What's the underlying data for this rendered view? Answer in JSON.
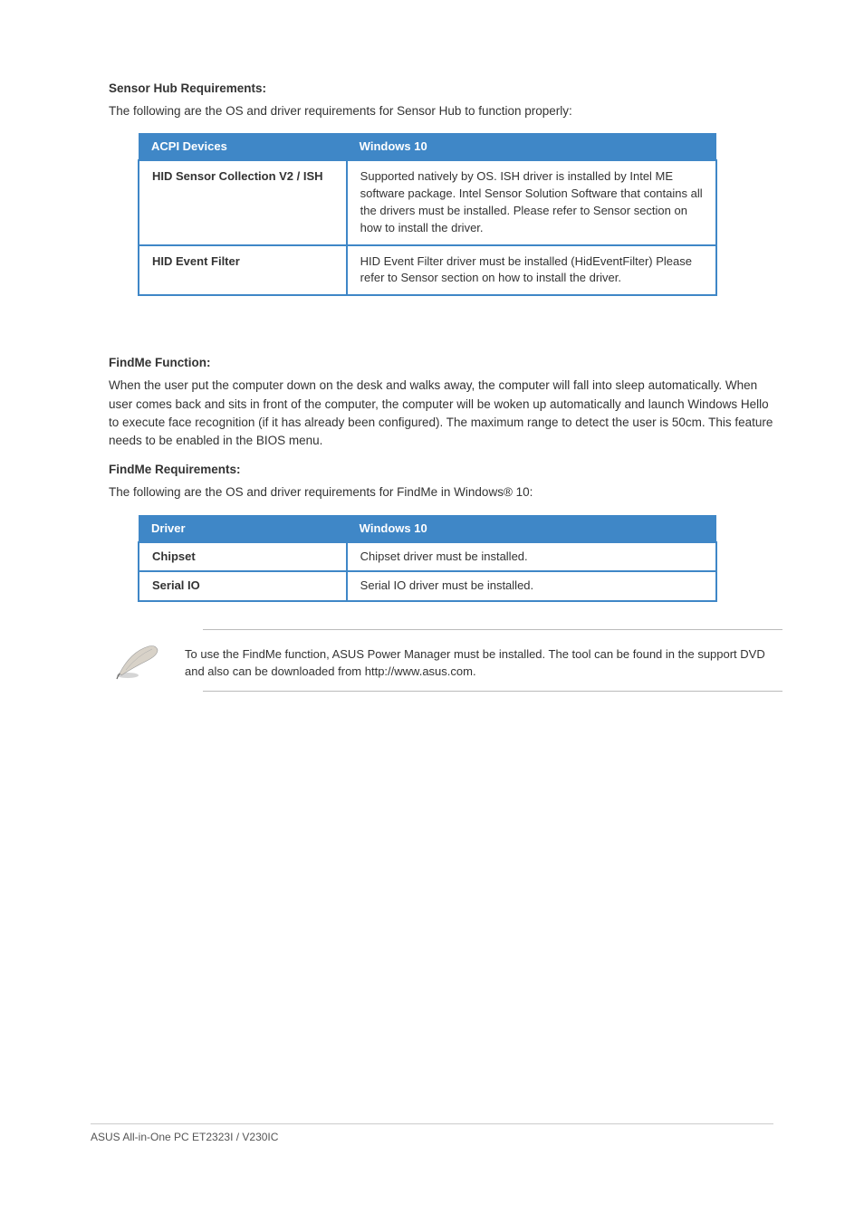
{
  "s1": {
    "title": "Sensor Hub Requirements:",
    "lead": "The following are the OS and driver requirements for Sensor Hub to function properly:",
    "table_header_left": "ACPI Devices",
    "table_header_right": "Windows 10",
    "rows": [
      {
        "left": "HID Sensor Collection V2 / ISH",
        "right": "Supported natively by OS. ISH driver is installed by Intel ME software package. Intel Sensor Solution Software that contains all the drivers must be installed. Please refer to Sensor section on how to install the driver."
      },
      {
        "left": "HID Event Filter",
        "right": "HID Event Filter driver must be installed (HidEventFilter) Please refer to Sensor section on how to install the driver."
      }
    ]
  },
  "s2": {
    "title": "FindMe Function:",
    "lead": "When the user put the computer down on the desk and walks away, the computer will fall into sleep automatically. When user comes back and sits in front of the computer, the computer will be woken up automatically and launch Windows Hello to execute face recognition (if it has already been configured). The maximum range to detect the user is 50cm. This feature needs to be enabled in the BIOS menu.",
    "subtitle": "FindMe Requirements:",
    "sublead": "The following are the OS and driver requirements for FindMe in Windows® 10:",
    "table_header_left": "Driver",
    "table_header_right": "Windows 10",
    "rows": [
      {
        "left": "Chipset",
        "right": "Chipset driver must be installed."
      },
      {
        "left": "Serial IO",
        "right": "Serial IO driver must be installed."
      }
    ]
  },
  "note": "To use the FindMe function, ASUS Power Manager must be installed. The tool can be found in the support DVD and also can be downloaded from http://www.asus.com.",
  "footer": "ASUS All-in-One PC ET2323I / V230IC"
}
